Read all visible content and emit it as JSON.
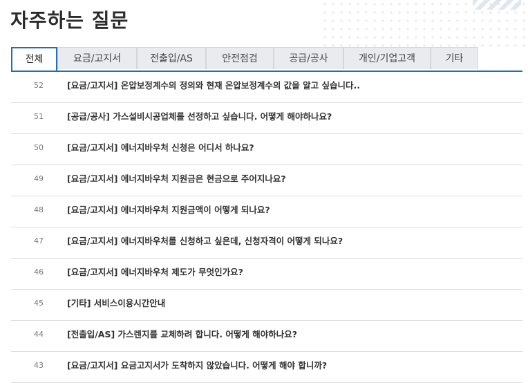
{
  "page": {
    "title": "자주하는 질문"
  },
  "tabs": [
    {
      "label": "전체",
      "active": true
    },
    {
      "label": "요금/고지서"
    },
    {
      "label": "전출입/AS"
    },
    {
      "label": "안전점검"
    },
    {
      "label": "공급/공사"
    },
    {
      "label": "개인/기업고객"
    },
    {
      "label": "기타"
    }
  ],
  "faq": [
    {
      "num": "52",
      "category": "[요금/고지서]",
      "question": "온압보정계수의 정의와 현재 온압보정계수의 값을 알고 싶습니다.."
    },
    {
      "num": "51",
      "category": "[공급/공사]",
      "question": "가스설비시공업체를 선정하고 싶습니다. 어떻게 해야하나요?"
    },
    {
      "num": "50",
      "category": "[요금/고지서]",
      "question": "에너지바우처 신청은 어디서 하나요?"
    },
    {
      "num": "49",
      "category": "[요금/고지서]",
      "question": "에너지바우처 지원금은 현금으로 주어지나요?"
    },
    {
      "num": "48",
      "category": "[요금/고지서]",
      "question": "에너지바우처 지원금액이 어떻게 되나요?"
    },
    {
      "num": "47",
      "category": "[요금/고지서]",
      "question": "에너지바우처를 신청하고 싶은데, 신청자격이 어떻게 되나요?"
    },
    {
      "num": "46",
      "category": "[요금/고지서]",
      "question": "에너지바우처 제도가 무엇인가요?"
    },
    {
      "num": "45",
      "category": "[기타]",
      "question": "서비스이용시간안내"
    },
    {
      "num": "44",
      "category": "[전출입/AS]",
      "question": "가스렌지를 교체하려 합니다. 어떻게 해야하나요?"
    },
    {
      "num": "43",
      "category": "[요금/고지서]",
      "question": "요금고지서가 도착하지 않았습니다. 어떻게 해야 합니까?"
    }
  ]
}
